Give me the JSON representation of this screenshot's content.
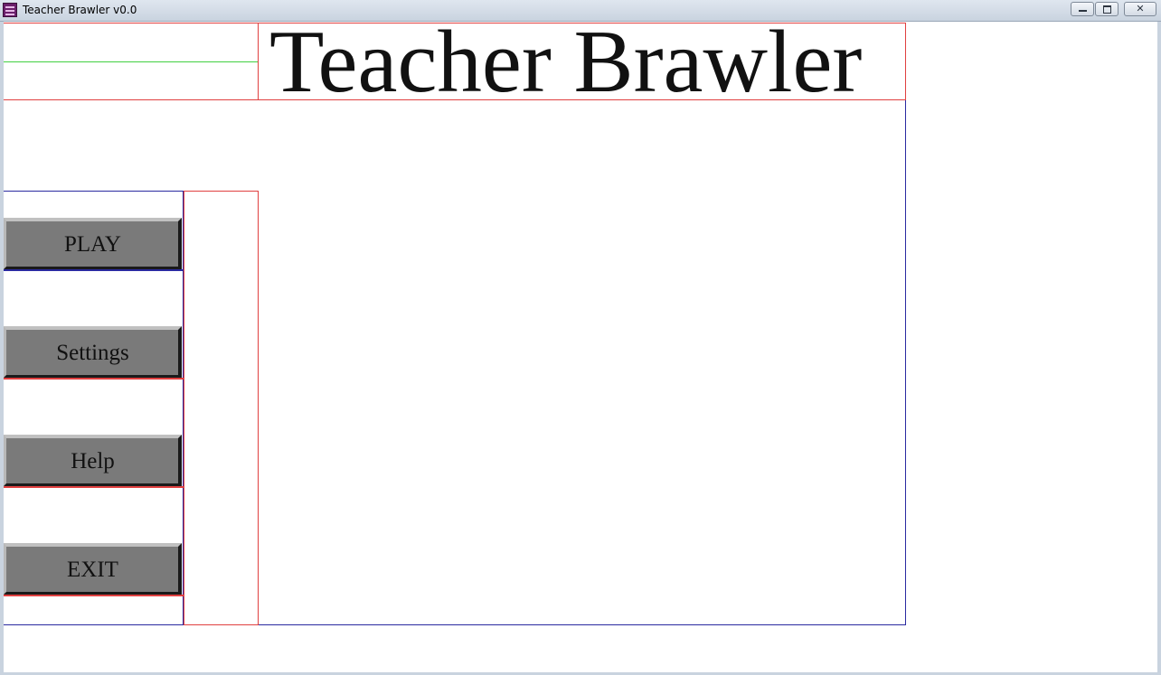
{
  "window": {
    "title": "Teacher Brawler v0.0",
    "controls": {
      "minimize": "minimize-icon",
      "maximize": "maximize-icon",
      "close": "✕"
    }
  },
  "game": {
    "title": "Teacher Brawler"
  },
  "menu": {
    "play": "PLAY",
    "settings": "Settings",
    "help": "Help",
    "exit": "EXIT"
  },
  "colors": {
    "button_face": "#7a7a7a",
    "debug_red": "#e04040",
    "debug_blue": "#2a2aa0",
    "debug_green": "#40d040"
  }
}
